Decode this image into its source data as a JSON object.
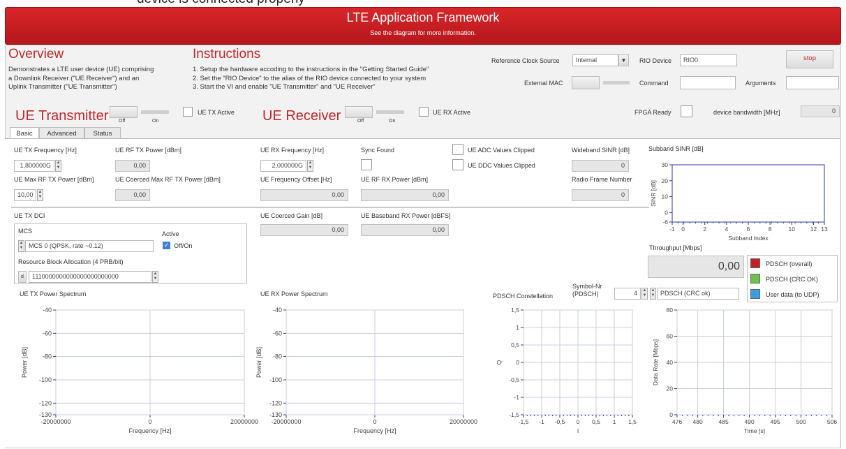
{
  "top_cut_text": "device is connected properly",
  "banner": {
    "title": "LTE Application Framework",
    "subtitle": "See the diagram for more information."
  },
  "overview": {
    "heading": "Overview",
    "lines": [
      "Demonstrates a LTE user device (UE) comprising",
      "a Downlink Receiver (\"UE Receiver\") and an",
      "Uplink Transmitter (\"UE Transmitter\")"
    ]
  },
  "instructions": {
    "heading": "Instructions",
    "lines": [
      "1. Setup the hardware accoding to the instructions in the \"Getting Started Guide\"",
      "2. Set the \"RIO Device\" to the alias of the RIO device connected to your system",
      "3. Start the VI and enable \"UE Transmitter\" and \"UE Receiver\""
    ]
  },
  "config": {
    "ref_clock_label": "Reference Clock Source",
    "ref_clock_value": "Internal",
    "rio_label": "RIO Device",
    "rio_value": "RIO0",
    "stop_label": "stop",
    "ext_mac_label": "External MAC",
    "command_label": "Command",
    "arguments_label": "Arguments",
    "fpga_ready_label": "FPGA Ready",
    "bandwidth_label": "device bandwidth [MHz]",
    "bandwidth_value": "0"
  },
  "ue_tx": {
    "heading": "UE Transmitter",
    "off": "Off",
    "on": "On",
    "active_label": "UE TX Active"
  },
  "ue_rx": {
    "heading": "UE Receiver",
    "off": "Off",
    "on": "On",
    "active_label": "UE RX Active"
  },
  "tabs": [
    "Basic",
    "Advanced",
    "Status"
  ],
  "basic": {
    "tx_freq_label": "UE TX Frequency [Hz]",
    "tx_freq_value": "1,800000G",
    "rf_tx_power_label": "UE RF TX Power [dBm]",
    "rf_tx_power_value": "0,00",
    "max_rf_tx_label": "UE Max RF TX Power [dBm]",
    "max_rf_tx_value": "10,00",
    "coerced_max_label": "UE Coerced Max RF TX Power [dBm]",
    "coerced_max_value": "0,00",
    "rx_freq_label": "UE RX Frequency [Hz]",
    "rx_freq_value": "2,000000G",
    "sync_found_label": "Sync Found",
    "adc_clipped_label": "UE ADC Values Clipped",
    "ddc_clipped_label": "UE DDC Values Clipped",
    "freq_offset_label": "UE Frequency Offset [Hz]",
    "freq_offset_value": "0,00",
    "rf_rx_power_label": "UE RF RX Power [dBm]",
    "rf_rx_power_value": "0,00",
    "wideband_sinr_label": "Wideband SINR [dB]",
    "wideband_sinr_value": "0",
    "radio_frame_label": "Radio Frame Number",
    "radio_frame_value": "0",
    "tx_dci_label": "UE TX DCI",
    "mcs_label": "MCS",
    "mcs_value": "MCS 0 (QPSK, rate ~0.12)",
    "active_label": "Active",
    "offon_label": "Off/On",
    "rba_label": "Resource Block Allocation (4 PRB/bit)",
    "rba_value": "1110000000000000000000000",
    "coerced_gain_label": "UE Coerced Gain [dB]",
    "coerced_gain_value": "0,00",
    "bb_rx_power_label": "UE Baseband RX Power [dBFS]",
    "bb_rx_power_value": "0,00",
    "subband_sinr_label": "Subband SINR [dB]",
    "throughput_label": "Throughput [Mbps]",
    "throughput_value": "0,00",
    "legend": [
      "PDSCH (overall)",
      "PDSCH (CRC OK)",
      "User data (to UDP)"
    ],
    "tx_spectrum_label": "UE TX Power Spectrum",
    "rx_spectrum_label": "UE RX Power Spectrum",
    "constellation_label": "PDSCH Constellation",
    "symbol_nr_label": "Symbol-Nr\n(PDSCH)",
    "symbol_nr_value": "4",
    "pdsch_select_value": "PDSCH (CRC ok)"
  },
  "colors": {
    "banner": "#c81e23",
    "heading_red": "#c0282c",
    "legend_overall": "#c81e23",
    "legend_crc": "#6cc24a",
    "legend_udp": "#3aa0e0",
    "plot_grid": "#c8cde6",
    "plot_axis": "#2e3a8c"
  },
  "chart_data": [
    {
      "type": "line",
      "title": "UE TX Power Spectrum",
      "xlabel": "Frequency [Hz]",
      "ylabel": "Power [dB]",
      "xlim": [
        -20000000,
        20000000
      ],
      "ylim": [
        -130,
        -40
      ],
      "xticks": [
        "-20000000",
        "0",
        "20000000"
      ],
      "yticks": [
        "-40",
        "-60",
        "-80",
        "-100",
        "-120",
        "-130"
      ],
      "series": []
    },
    {
      "type": "line",
      "title": "UE RX Power Spectrum",
      "xlabel": "Frequency [Hz]",
      "ylabel": "Power [dB]",
      "xlim": [
        -20000000,
        20000000
      ],
      "ylim": [
        -130,
        -40
      ],
      "xticks": [
        "-20000000",
        "0",
        "20000000"
      ],
      "yticks": [
        "-40",
        "-60",
        "-80",
        "-100",
        "-120",
        "-130"
      ],
      "series": []
    },
    {
      "type": "scatter",
      "title": "PDSCH Constellation",
      "xlabel": "I",
      "ylabel": "Q",
      "xlim": [
        -1.5,
        1.5
      ],
      "ylim": [
        -1.5,
        1.5
      ],
      "xticks": [
        "-1,5",
        "-1",
        "-0,5",
        "0",
        "0,5",
        "1",
        "1,5"
      ],
      "yticks": [
        "1,5",
        "1",
        "0,5",
        "0",
        "-0,5",
        "-1",
        "-1,5"
      ],
      "series": []
    },
    {
      "type": "line",
      "title": "",
      "xlabel": "Time [s]",
      "ylabel": "Data Rate [Mbps]",
      "xlim": [
        476,
        506
      ],
      "ylim": [
        0,
        80
      ],
      "xticks": [
        "476",
        "480",
        "485",
        "490",
        "495",
        "500",
        "506"
      ],
      "yticks": [
        "80",
        "60",
        "40",
        "20",
        "0"
      ],
      "series": []
    },
    {
      "type": "line",
      "title": "Subband SINR [dB]",
      "xlabel": "Subband Index",
      "ylabel": "SINR [dB]",
      "xlim": [
        -1,
        13
      ],
      "ylim": [
        -6,
        30
      ],
      "xticks": [
        "-1",
        "0",
        "2",
        "4",
        "6",
        "8",
        "10",
        "12",
        "13"
      ],
      "yticks": [
        "30",
        "20",
        "10",
        "0",
        "-6"
      ],
      "series": []
    }
  ]
}
